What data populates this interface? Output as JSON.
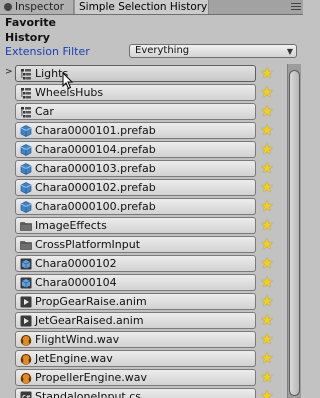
{
  "tabs": [
    {
      "label": "Inspector",
      "active": false
    },
    {
      "label": "Simple Selection History",
      "active": true
    }
  ],
  "headings": {
    "favorite": "Favorite",
    "history": "History"
  },
  "filter": {
    "label": "Extension Filter",
    "selected": "Everything"
  },
  "selected_row": 0,
  "items": [
    {
      "label": "Lights",
      "icon": "gameobject-icon",
      "favorite": true
    },
    {
      "label": "WheelsHubs",
      "icon": "gameobject-icon",
      "favorite": true
    },
    {
      "label": "Car",
      "icon": "gameobject-icon",
      "favorite": true
    },
    {
      "label": "Chara0000101.prefab",
      "icon": "prefab-icon",
      "favorite": true
    },
    {
      "label": "Chara0000104.prefab",
      "icon": "prefab-icon",
      "favorite": true
    },
    {
      "label": "Chara0000103.prefab",
      "icon": "prefab-icon",
      "favorite": true
    },
    {
      "label": "Chara0000102.prefab",
      "icon": "prefab-icon",
      "favorite": true
    },
    {
      "label": "Chara0000100.prefab",
      "icon": "prefab-icon",
      "favorite": true
    },
    {
      "label": "ImageEffects",
      "icon": "folder-icon",
      "favorite": true
    },
    {
      "label": "CrossPlatformInput",
      "icon": "folder-icon",
      "favorite": true
    },
    {
      "label": "Chara0000102",
      "icon": "model-icon",
      "favorite": true
    },
    {
      "label": "Chara0000104",
      "icon": "model-icon",
      "favorite": true
    },
    {
      "label": "PropGearRaise.anim",
      "icon": "animation-icon",
      "favorite": true
    },
    {
      "label": "JetGearRaised.anim",
      "icon": "animation-icon",
      "favorite": true
    },
    {
      "label": "FlightWind.wav",
      "icon": "audio-icon",
      "favorite": true
    },
    {
      "label": "JetEngine.wav",
      "icon": "audio-icon",
      "favorite": true
    },
    {
      "label": "PropellerEngine.wav",
      "icon": "audio-icon",
      "favorite": true
    },
    {
      "label": "StandaloneInput.cs",
      "icon": "script-icon",
      "favorite": true
    }
  ]
}
